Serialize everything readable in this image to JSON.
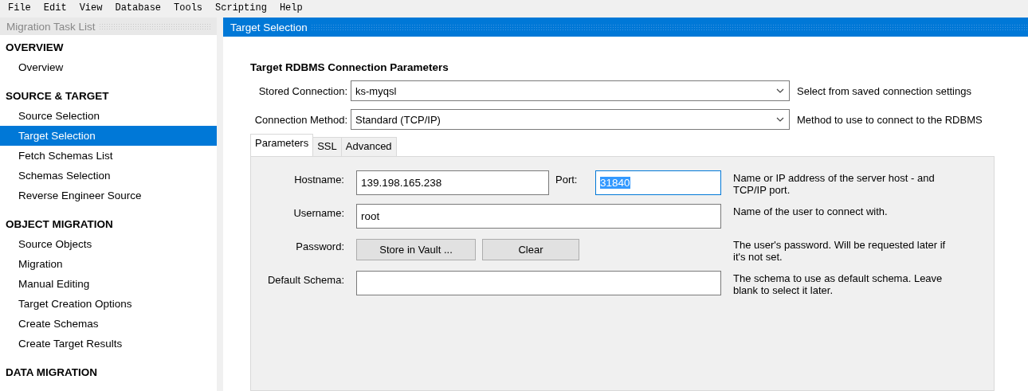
{
  "menu": [
    "File",
    "Edit",
    "View",
    "Database",
    "Tools",
    "Scripting",
    "Help"
  ],
  "task_list": {
    "title": "Migration Task List",
    "sections": [
      {
        "heading": "OVERVIEW",
        "items": [
          {
            "label": "Overview",
            "selected": false
          }
        ]
      },
      {
        "heading": "SOURCE & TARGET",
        "items": [
          {
            "label": "Source Selection",
            "selected": false
          },
          {
            "label": "Target Selection",
            "selected": true
          },
          {
            "label": "Fetch Schemas List",
            "selected": false
          },
          {
            "label": "Schemas Selection",
            "selected": false
          },
          {
            "label": "Reverse Engineer Source",
            "selected": false
          }
        ]
      },
      {
        "heading": "OBJECT MIGRATION",
        "items": [
          {
            "label": "Source Objects",
            "selected": false
          },
          {
            "label": "Migration",
            "selected": false
          },
          {
            "label": "Manual Editing",
            "selected": false
          },
          {
            "label": "Target Creation Options",
            "selected": false
          },
          {
            "label": "Create Schemas",
            "selected": false
          },
          {
            "label": "Create Target Results",
            "selected": false
          }
        ]
      },
      {
        "heading": "DATA MIGRATION"
      }
    ]
  },
  "page": {
    "title": "Target Selection",
    "heading": "Target RDBMS Connection Parameters",
    "selects": [
      {
        "label": "Stored Connection:",
        "value": "ks-myqsl",
        "help": "Select from saved connection settings"
      },
      {
        "label": "Connection Method:",
        "value": "Standard (TCP/IP)",
        "help": "Method to use to connect to the RDBMS"
      }
    ],
    "tabs": [
      {
        "label": "Parameters",
        "selected": true
      },
      {
        "label": "SSL",
        "selected": false
      },
      {
        "label": "Advanced",
        "selected": false
      }
    ],
    "fields": [
      {
        "kind": "host",
        "label": "Hostname:",
        "value": "139.198.165.238",
        "port_label": "Port:",
        "port_value": "31840",
        "port_text_selected": true,
        "help": "Name or IP address of the server host - and TCP/IP port."
      },
      {
        "kind": "text",
        "label": "Username:",
        "value": "root",
        "help": "Name of the user to connect with."
      },
      {
        "kind": "buttons",
        "label": "Password:",
        "buttons": [
          "Store in Vault ...",
          "Clear"
        ],
        "help": "The user's password. Will be requested later if it's not set."
      },
      {
        "kind": "text",
        "label": "Default Schema:",
        "help": "The schema to use as default schema. Leave blank to select it later."
      }
    ]
  }
}
